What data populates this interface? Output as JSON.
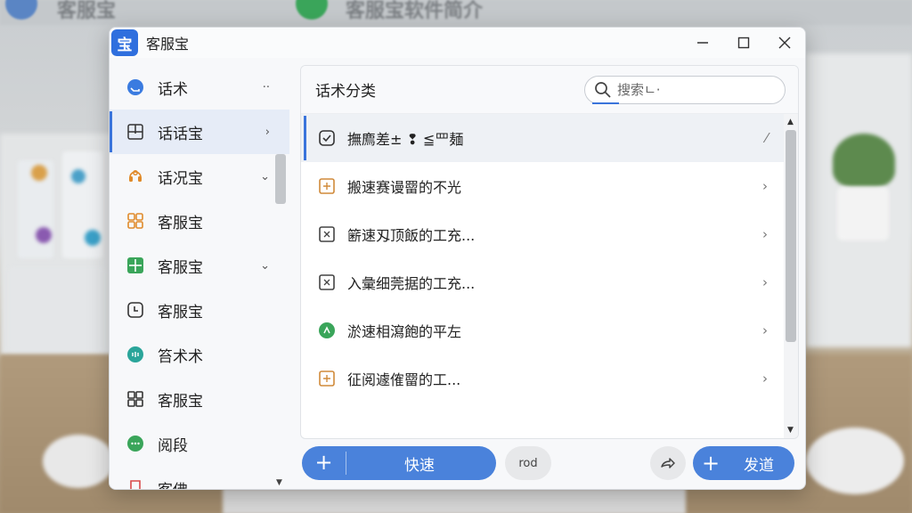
{
  "background": {
    "top_texts": [
      "客服宝",
      "客服宝软件简介"
    ]
  },
  "window": {
    "logo_char": "宝",
    "title": "客服宝",
    "controls": [
      "minimize",
      "maximize",
      "close"
    ]
  },
  "sidebar": {
    "items": [
      {
        "label": "话术",
        "icon": "chat-bubble-icon",
        "trail": "··",
        "color": "#3a7be0"
      },
      {
        "label": "话话宝",
        "icon": "grid-icon",
        "trail": "›",
        "active": true,
        "color": "#333333"
      },
      {
        "label": "话况宝",
        "icon": "headset-icon",
        "trail": "⌄",
        "color": "#e08a2a"
      },
      {
        "label": "客服宝",
        "icon": "apps-icon",
        "trail": "",
        "color": "#e08a2a"
      },
      {
        "label": "客服宝",
        "icon": "green-grid-icon",
        "trail": "⌄",
        "color": "#3aa55a"
      },
      {
        "label": "客服宝",
        "icon": "clock-icon",
        "trail": "",
        "color": "#333333"
      },
      {
        "label": "笞术术",
        "icon": "teal-chat-icon",
        "trail": "",
        "color": "#2aa59a"
      },
      {
        "label": "客服宝",
        "icon": "squares-icon",
        "trail": "",
        "color": "#333333"
      },
      {
        "label": "阅段",
        "icon": "green-chat-icon",
        "trail": "",
        "color": "#3aa55a"
      },
      {
        "label": "客佛",
        "icon": "bookmark-icon",
        "trail": "",
        "color": "#d94a4a"
      }
    ]
  },
  "panel": {
    "title": "话术分类",
    "search_placeholder": "搜索",
    "search_value": "搜索ㄴ·",
    "items": [
      {
        "label": "撫廌差± ❢   ≦罒麺",
        "icon": "check-square-icon",
        "trail": "⁄",
        "selected": true
      },
      {
        "label": "搬速赛谩罶的不光",
        "icon": "doc-orange-icon",
        "trail": "›"
      },
      {
        "label": "簖速刄顶飯的工充...",
        "icon": "doc-gray-icon",
        "trail": "›"
      },
      {
        "label": "入彙细莞据的工充...",
        "icon": "doc-gray-icon",
        "trail": "›"
      },
      {
        "label": "淤速相瀉飽的平左",
        "icon": "green-circle-icon",
        "trail": "›"
      },
      {
        "label": "征阅遽傕罶的工...",
        "icon": "doc-orange-icon",
        "trail": "›"
      }
    ]
  },
  "toolbar": {
    "quick_plus": "+",
    "quick_label": "快速",
    "small_label": "rod",
    "send_plus": "+",
    "send_label": "发道"
  },
  "colors": {
    "accent": "#4a82db",
    "active_bg": "#e6ecf7"
  }
}
